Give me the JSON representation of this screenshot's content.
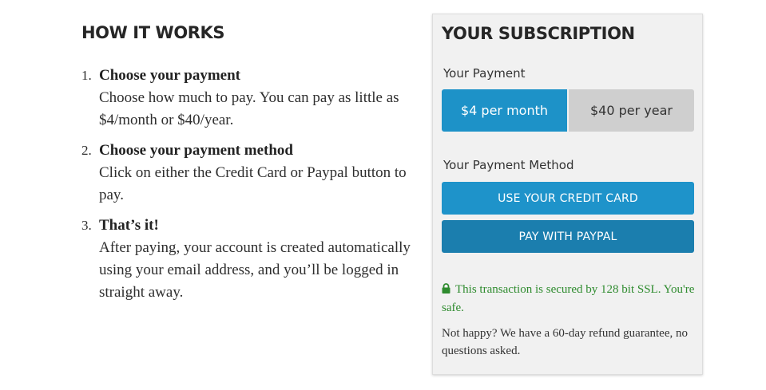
{
  "how_it_works": {
    "title": "HOW IT WORKS",
    "steps": [
      {
        "number": "1.",
        "title": "Choose your payment",
        "text": "Choose how much to pay. You can pay as little as $4/month or $40/year."
      },
      {
        "number": "2.",
        "title": "Choose your payment method",
        "text": "Click on either the Credit Card or Paypal button to pay."
      },
      {
        "number": "3.",
        "title": "That’s it!",
        "text": "After paying, your account is created automatically using your email address, and you’ll be logged in straight away."
      }
    ]
  },
  "subscription": {
    "title": "YOUR SUBSCRIPTION",
    "payment_label": "Your Payment",
    "payment_options": [
      {
        "label": "$4 per month",
        "selected": true
      },
      {
        "label": "$40 per year",
        "selected": false
      }
    ],
    "method_label": "Your Payment Method",
    "credit_card_button": "USE YOUR CREDIT CARD",
    "paypal_button": "PAY WITH PAYPAL",
    "secure_text": "This transaction is secured by 128 bit SSL. You're safe.",
    "refund_text": "Not happy? We have a 60-day refund guarantee, no questions asked."
  },
  "colors": {
    "accent": "#1d92c8",
    "paypal": "#1b7eae",
    "unselected": "#cfcfcf",
    "secure_green": "#2e8b2e",
    "panel_bg": "#f1f1f1"
  },
  "icons": {
    "secure": "lock-icon"
  }
}
